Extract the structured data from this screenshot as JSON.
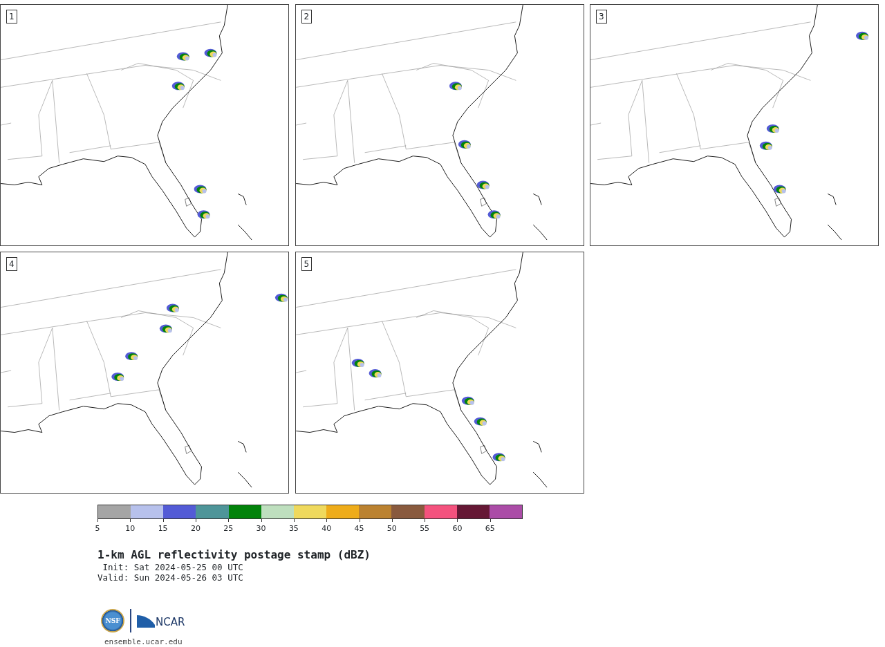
{
  "panels": [
    {
      "label": "1"
    },
    {
      "label": "2"
    },
    {
      "label": "3"
    },
    {
      "label": "4"
    },
    {
      "label": "5"
    }
  ],
  "colorbar": {
    "segments": [
      {
        "color": "#a5a5a5"
      },
      {
        "color": "#b7c1ec"
      },
      {
        "color": "#535bd6"
      },
      {
        "color": "#4e9599"
      },
      {
        "color": "#02830a"
      },
      {
        "color": "#bedfbe"
      },
      {
        "color": "#efd95d"
      },
      {
        "color": "#eeac1a"
      },
      {
        "color": "#bb8230"
      },
      {
        "color": "#895a3e"
      },
      {
        "color": "#f4527e"
      },
      {
        "color": "#651835"
      },
      {
        "color": "#ab4ca7"
      }
    ],
    "ticks": [
      "5",
      "10",
      "15",
      "20",
      "25",
      "30",
      "35",
      "40",
      "45",
      "50",
      "55",
      "60",
      "65"
    ]
  },
  "title": "1-km AGL reflectivity postage stamp (dBZ)",
  "init": " Init: Sat 2024-05-25 00 UTC",
  "valid": "Valid: Sun 2024-05-26 03 UTC",
  "logo": {
    "left": "NSF",
    "right": "NCAR"
  },
  "url": "ensemble.ucar.edu"
}
